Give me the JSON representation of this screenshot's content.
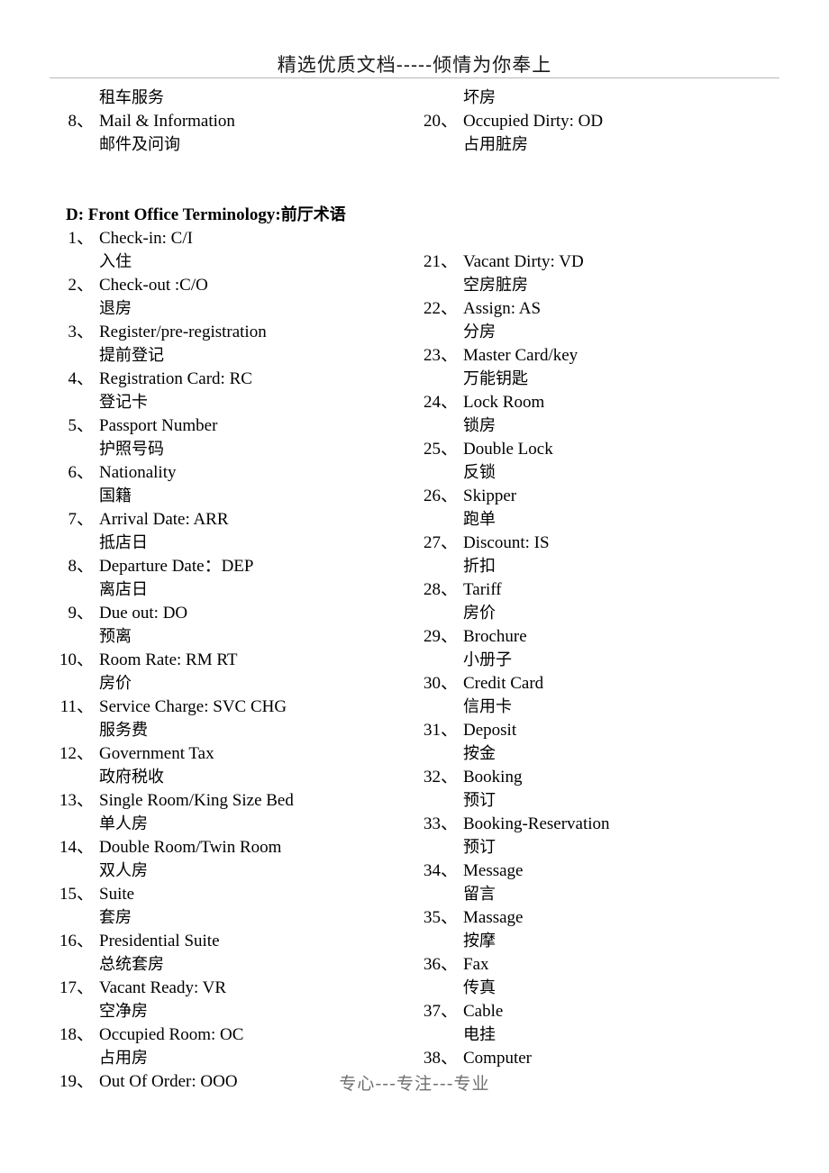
{
  "header": {
    "text": "精选优质文档-----倾情为你奉上"
  },
  "footer": {
    "text": "专心---专注---专业"
  },
  "left_column": {
    "continued_translation": "租车服务",
    "item8": {
      "num": "8、",
      "label": "Mail & Information",
      "trans": "邮件及问询"
    },
    "section_heading": {
      "latin": "D: Front Office Terminology:",
      "cjk": "前厅术语"
    },
    "items": [
      {
        "num": "1、",
        "label": "Check-in: C/I",
        "trans": "入住"
      },
      {
        "num": "2、",
        "label": "Check-out :C/O",
        "trans": "退房"
      },
      {
        "num": "3、",
        "label": "Register/pre-registration",
        "trans": "提前登记"
      },
      {
        "num": "4、",
        "label": "Registration Card: RC",
        "trans": "登记卡"
      },
      {
        "num": "5、",
        "label": "Passport Number",
        "trans": "护照号码"
      },
      {
        "num": "6、",
        "label": "Nationality",
        "trans": "国籍"
      },
      {
        "num": "7、",
        "label": "Arrival Date: ARR",
        "trans": "抵店日"
      },
      {
        "num": "8、",
        "label": "Departure Date：DEP",
        "trans": "离店日"
      },
      {
        "num": "9、",
        "label": "Due out: DO",
        "trans": "预离"
      },
      {
        "num": "10、",
        "label": "Room Rate: RM RT",
        "trans": "房价"
      },
      {
        "num": "11、",
        "label": "Service Charge: SVC CHG",
        "trans": "服务费"
      },
      {
        "num": "12、",
        "label": "Government Tax",
        "trans": "政府税收"
      },
      {
        "num": "13、",
        "label": "Single Room/King Size Bed",
        "trans": "单人房"
      },
      {
        "num": "14、",
        "label": "Double Room/Twin Room",
        "trans": "双人房"
      },
      {
        "num": "15、",
        "label": "Suite",
        "trans": "套房"
      },
      {
        "num": "16、",
        "label": "Presidential Suite",
        "trans": "总统套房"
      },
      {
        "num": "17、",
        "label": "Vacant Ready: VR",
        "trans": "空净房"
      },
      {
        "num": "18、",
        "label": "Occupied Room: OC",
        "trans": "占用房"
      },
      {
        "num": "19、",
        "label": "Out Of Order: OOO",
        "trans": ""
      }
    ]
  },
  "right_column": {
    "continued_translation": "坏房",
    "item20": {
      "num": "20、",
      "label": "Occupied Dirty: OD",
      "trans": "占用脏房"
    },
    "items": [
      {
        "num": "21、",
        "label": "Vacant Dirty: VD",
        "trans": "空房脏房"
      },
      {
        "num": "22、",
        "label": "Assign: AS",
        "trans": "分房"
      },
      {
        "num": "23、",
        "label": "Master Card/key",
        "trans": "万能钥匙"
      },
      {
        "num": "24、",
        "label": "Lock Room",
        "trans": "锁房"
      },
      {
        "num": "25、",
        "label": "Double Lock",
        "trans": "反锁"
      },
      {
        "num": "26、",
        "label": "Skipper",
        "trans": "跑单"
      },
      {
        "num": "27、",
        "label": "Discount: IS",
        "trans": "折扣"
      },
      {
        "num": "28、",
        "label": "Tariff",
        "trans": "房价"
      },
      {
        "num": "29、",
        "label": "Brochure",
        "trans": "小册子"
      },
      {
        "num": "30、",
        "label": "Credit Card",
        "trans": "信用卡"
      },
      {
        "num": "31、",
        "label": "Deposit",
        "trans": "按金"
      },
      {
        "num": "32、",
        "label": "Booking",
        "trans": "预订"
      },
      {
        "num": "33、",
        "label": "Booking-Reservation",
        "trans": "预订"
      },
      {
        "num": "34、",
        "label": "Message",
        "trans": "留言"
      },
      {
        "num": "35、",
        "label": "Massage",
        "trans": "按摩"
      },
      {
        "num": "36、",
        "label": "Fax",
        "trans": "传真"
      },
      {
        "num": "37、",
        "label": "Cable",
        "trans": "电挂"
      },
      {
        "num": "38、",
        "label": "Computer",
        "trans": ""
      }
    ]
  }
}
